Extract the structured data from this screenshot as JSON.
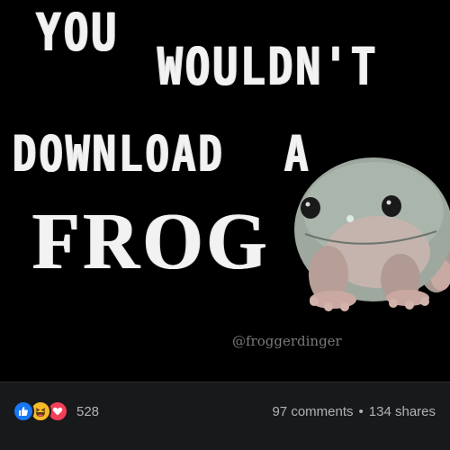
{
  "post": {
    "meme_lines": [
      "YOU",
      "WOULDN'T",
      "DOWNLOAD",
      "A",
      "FROG"
    ],
    "watermark": "@froggerdinger"
  },
  "footer": {
    "reactions": [
      "like-icon",
      "haha-icon",
      "love-icon"
    ],
    "reaction_count": "528",
    "comments": "97 comments",
    "separator": "•",
    "shares": "134 shares"
  },
  "colors": {
    "background": "#000000",
    "footer_bg": "#18191a",
    "footer_text": "#b0b3b8",
    "like": "#1877f2",
    "haha": "#f7b928",
    "love": "#f33e58"
  }
}
